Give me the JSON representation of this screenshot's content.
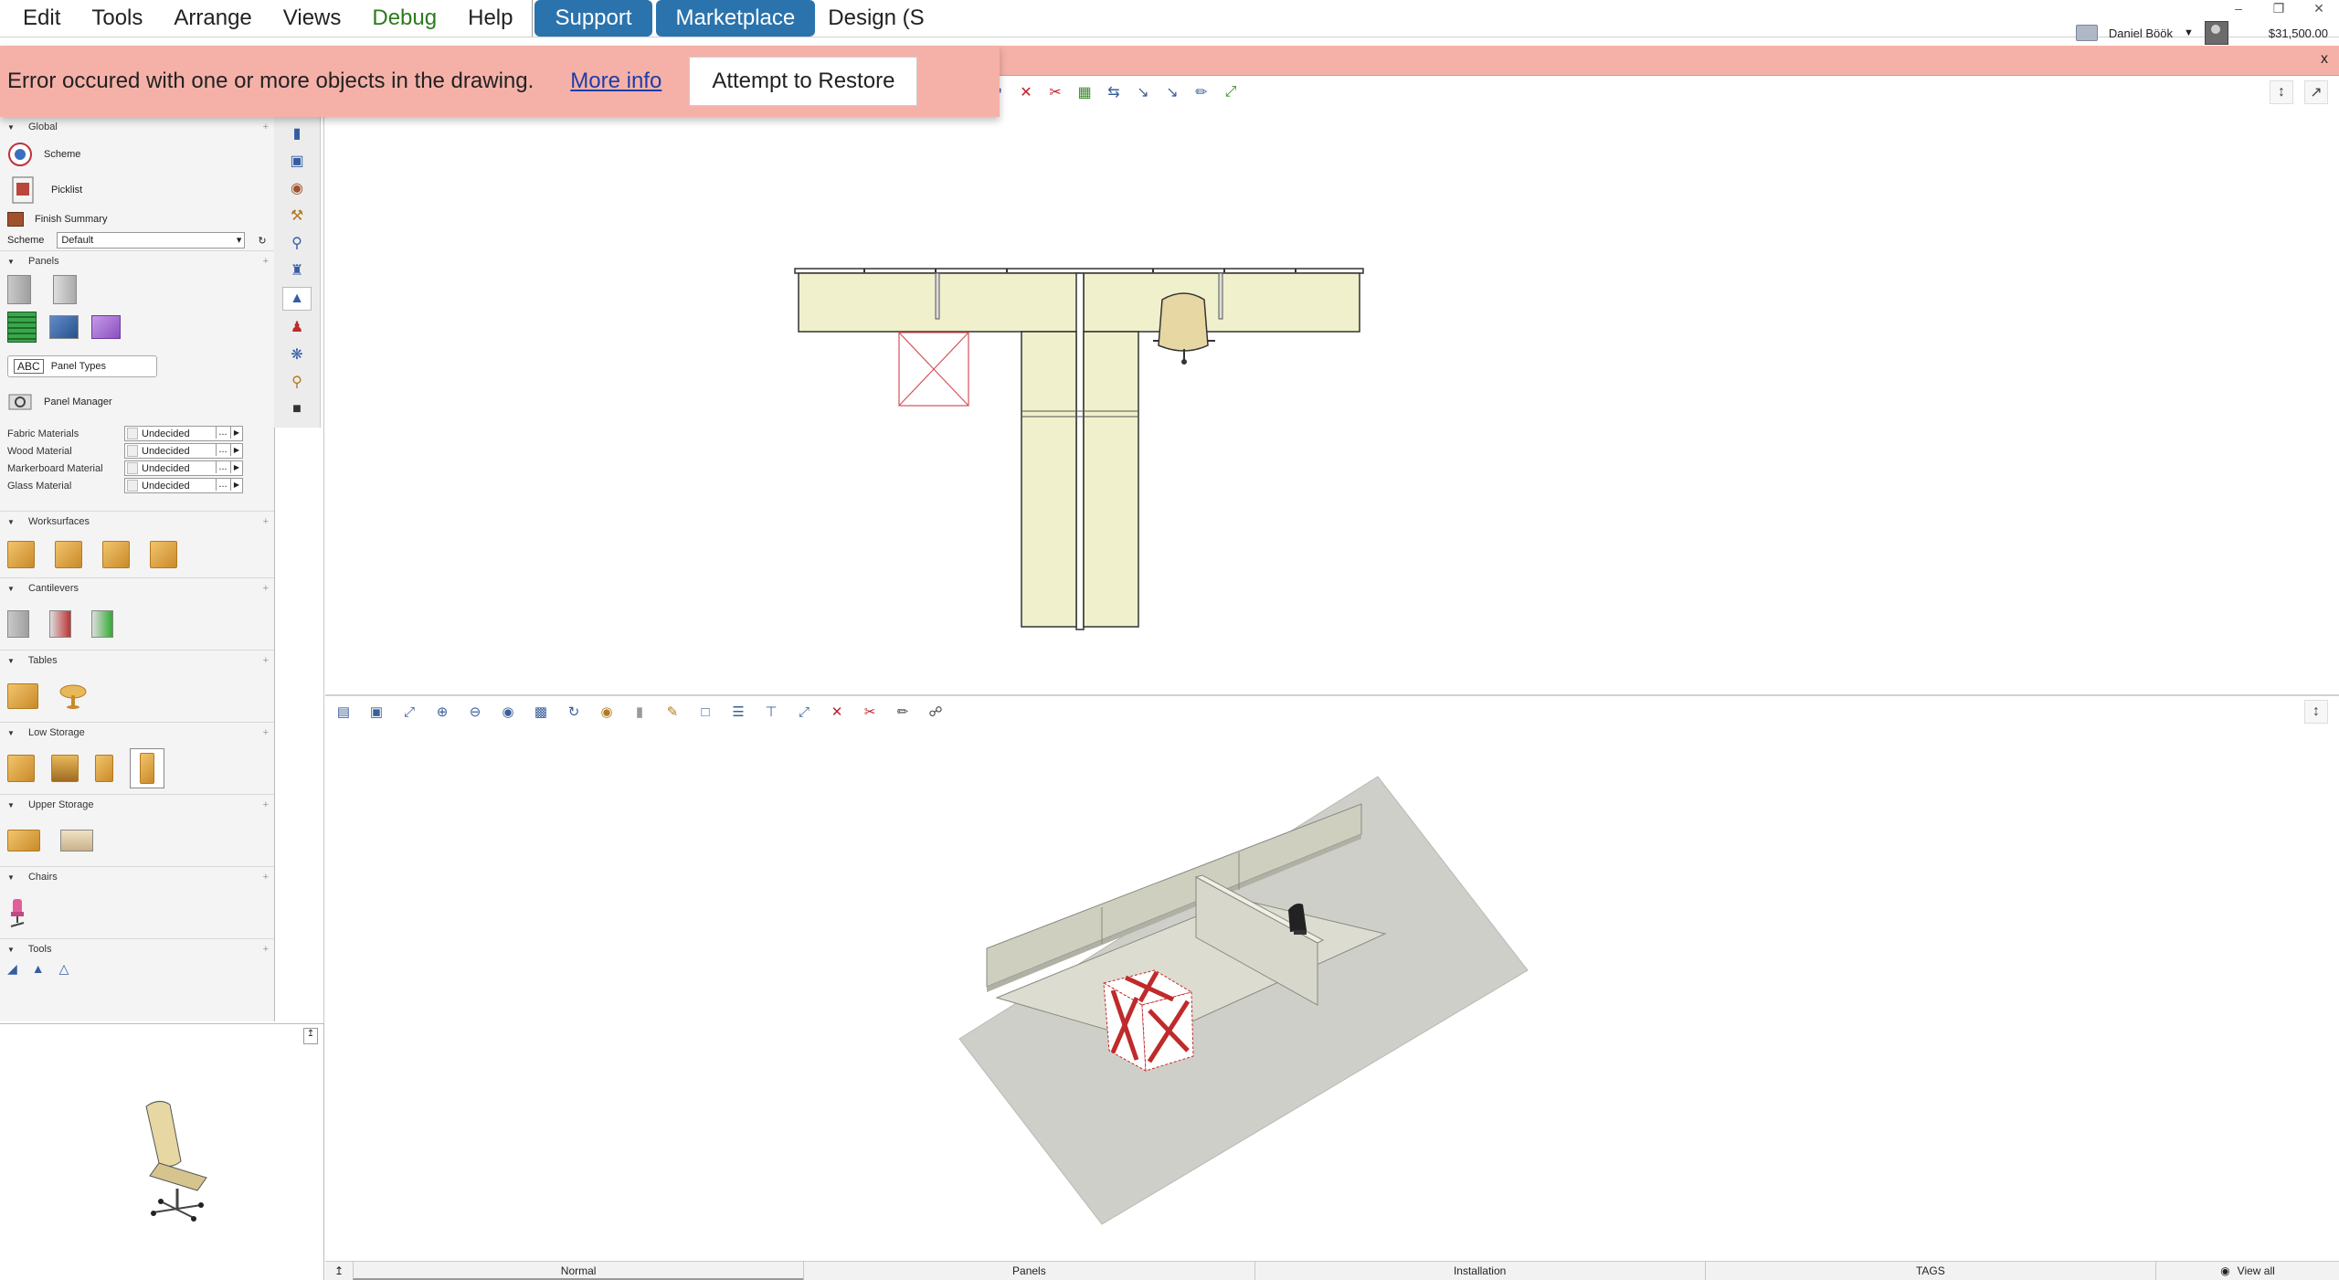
{
  "menu": {
    "items": [
      "Edit",
      "Tools",
      "Arrange",
      "Views",
      "Debug",
      "Help"
    ],
    "support": "Support",
    "marketplace": "Marketplace",
    "design": "Design (S"
  },
  "user": {
    "name": "Daniel Böök",
    "total": "$31,500.00"
  },
  "error": {
    "message": "Error occured with one or more objects in the drawing.",
    "more_info": "More info",
    "restore": "Attempt to Restore",
    "close": "x"
  },
  "catalog": {
    "global": {
      "title": "Global",
      "scheme_btn": "Scheme",
      "picklist_btn": "Picklist",
      "finish_summary": "Finish Summary",
      "scheme_label": "Scheme",
      "scheme_value": "Default"
    },
    "panels": {
      "title": "Panels",
      "panel_types": "Panel Types",
      "panel_manager": "Panel Manager",
      "materials": [
        {
          "label": "Fabric Materials",
          "value": "Undecided"
        },
        {
          "label": "Wood Material",
          "value": "Undecided"
        },
        {
          "label": "Markerboard Material",
          "value": "Undecided"
        },
        {
          "label": "Glass Material",
          "value": "Undecided"
        }
      ]
    },
    "worksurfaces": {
      "title": "Worksurfaces"
    },
    "cantilevers": {
      "title": "Cantilevers"
    },
    "tables": {
      "title": "Tables"
    },
    "low_storage": {
      "title": "Low Storage"
    },
    "upper_storage": {
      "title": "Upper Storage"
    },
    "chairs": {
      "title": "Chairs"
    },
    "tools": {
      "title": "Tools"
    }
  },
  "statusbar": {
    "tabs": [
      "Normal",
      "Panels",
      "Installation",
      "TAGS"
    ],
    "view_all": "View all"
  },
  "colors": {
    "accent": "#2b73ad",
    "error_bg": "#f5b1a8",
    "panel_fill": "#f0f0cc",
    "wood": "#e8b95a"
  }
}
